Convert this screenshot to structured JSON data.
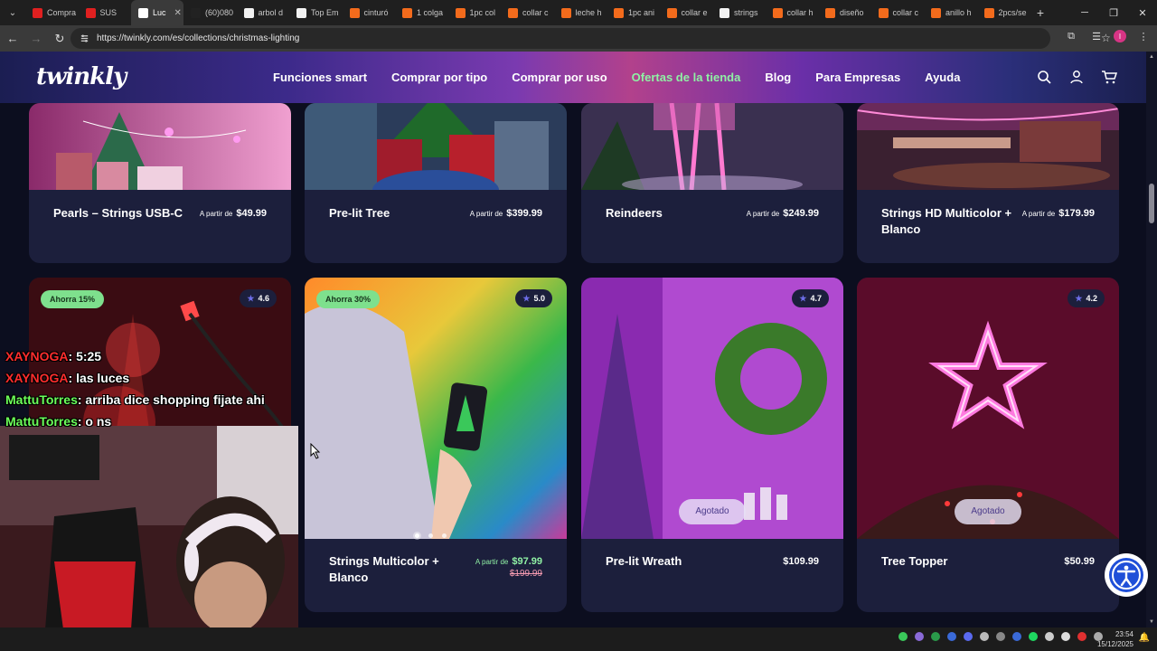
{
  "browser": {
    "tabs": [
      {
        "label": "Compra",
        "color": "#e02020"
      },
      {
        "label": "SUS",
        "color": "#e02020"
      },
      {
        "label": "Luc",
        "color": "#ffffff",
        "active": true
      },
      {
        "label": "(60)080",
        "color": "#222222"
      },
      {
        "label": "arbol d",
        "color": "#f2f2f2"
      },
      {
        "label": "Top Em",
        "color": "#f2f2f2"
      },
      {
        "label": "cinturó",
        "color": "#f36b1c"
      },
      {
        "label": "1 colga",
        "color": "#f36b1c"
      },
      {
        "label": "1pc col",
        "color": "#f36b1c"
      },
      {
        "label": "collar c",
        "color": "#f36b1c"
      },
      {
        "label": "leche h",
        "color": "#f36b1c"
      },
      {
        "label": "1pc ani",
        "color": "#f36b1c"
      },
      {
        "label": "collar e",
        "color": "#f36b1c"
      },
      {
        "label": "strings",
        "color": "#f2f2f2"
      },
      {
        "label": "collar h",
        "color": "#f36b1c"
      },
      {
        "label": "diseño",
        "color": "#f36b1c"
      },
      {
        "label": "collar c",
        "color": "#f36b1c"
      },
      {
        "label": "anillo h",
        "color": "#f36b1c"
      },
      {
        "label": "2pcs/se",
        "color": "#f36b1c"
      }
    ],
    "url": "https://twinkly.com/es/collections/christmas-lighting",
    "profile_initial": "I"
  },
  "site": {
    "logo": "twinkly",
    "nav": [
      "Funciones smart",
      "Comprar por tipo",
      "Comprar por uso",
      "Ofertas de la tienda",
      "Blog",
      "Para Empresas",
      "Ayuda"
    ]
  },
  "top_row": [
    {
      "name": "Pearls – Strings USB-C",
      "price_prefix": "A partir de",
      "price": "$49.99"
    },
    {
      "name": "Pre-lit Tree",
      "price_prefix": "A partir de",
      "price": "$399.99"
    },
    {
      "name": "Reindeers",
      "price_prefix": "A partir de",
      "price": "$249.99"
    },
    {
      "name": "Strings HD Multicolor + Blanco",
      "price_prefix": "A partir de",
      "price": "$179.99"
    }
  ],
  "bottom_row": [
    {
      "name": "",
      "badge": "Ahorra 15%",
      "rating": "4.6"
    },
    {
      "name": "Strings Multicolor + Blanco",
      "badge": "Ahorra 30%",
      "rating": "5.0",
      "price_prefix": "A partir de",
      "price": "$97.99",
      "old_price": "$199.99"
    },
    {
      "name": "Pre-lit Wreath",
      "rating": "4.7",
      "price": "$109.99",
      "status": "Agotado"
    },
    {
      "name": "Tree Topper",
      "rating": "4.2",
      "price": "$50.99",
      "status": "Agotado"
    }
  ],
  "chat": [
    {
      "user": "XAYNOGA",
      "message": ": 5:25"
    },
    {
      "user": "XAYNOGA",
      "message": ": las luces"
    },
    {
      "user": "MattuTorres",
      "message": ": arriba dice shopping fijate ahi"
    },
    {
      "user": "MattuTorres",
      "message": ": o ns"
    }
  ],
  "taskbar": {
    "time": "23:54",
    "date": "15/12/2025"
  }
}
